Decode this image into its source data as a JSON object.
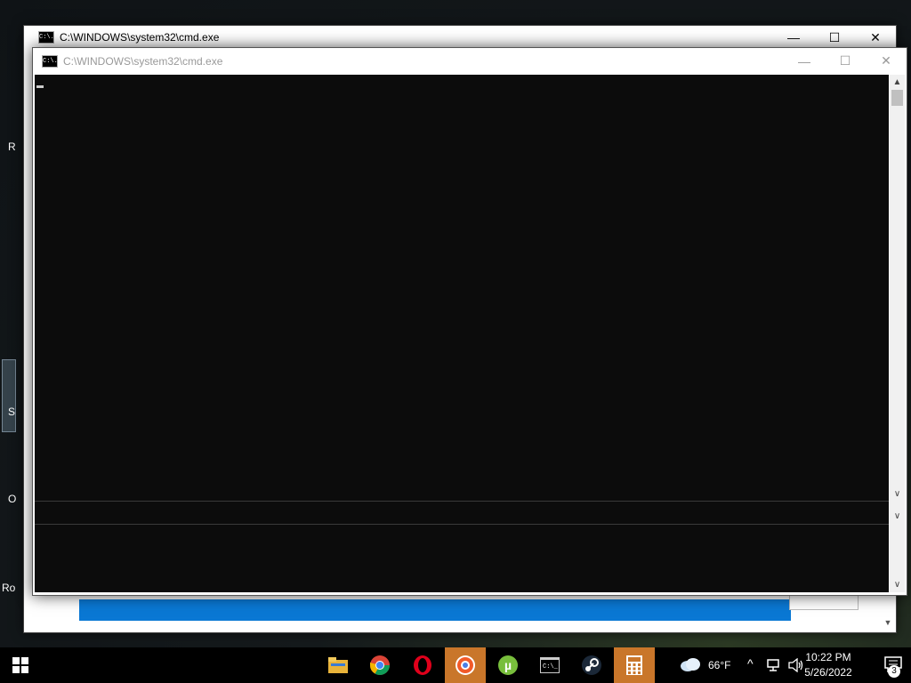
{
  "desktop": {
    "labels": [
      "R",
      "S",
      "O",
      "Ro"
    ]
  },
  "back_window": {
    "title": "C:\\WINDOWS\\system32\\cmd.exe",
    "icon_text": "C:\\.",
    "minimize": "—",
    "maximize": "☐",
    "close": "✕",
    "scroll_down": "▼"
  },
  "front_window": {
    "title": "C:\\WINDOWS\\system32\\cmd.exe",
    "icon_text": "C:\\.",
    "minimize": "—",
    "maximize": "☐",
    "close": "✕",
    "scroll_up": "▲",
    "scroll_down_1": "∨",
    "scroll_down_2": "∨",
    "scroll_down_3": "∨"
  },
  "taskbar": {
    "apps": [
      "file-explorer-icon",
      "chrome-icon",
      "opera-icon",
      "brave-icon",
      "utorrent-icon",
      "cmd-icon",
      "steam-icon",
      "calculator-icon"
    ],
    "weather": "66°F",
    "tray_chevron": "^",
    "time": "10:22 PM",
    "date": "5/26/2022",
    "notifications_count": "3"
  }
}
